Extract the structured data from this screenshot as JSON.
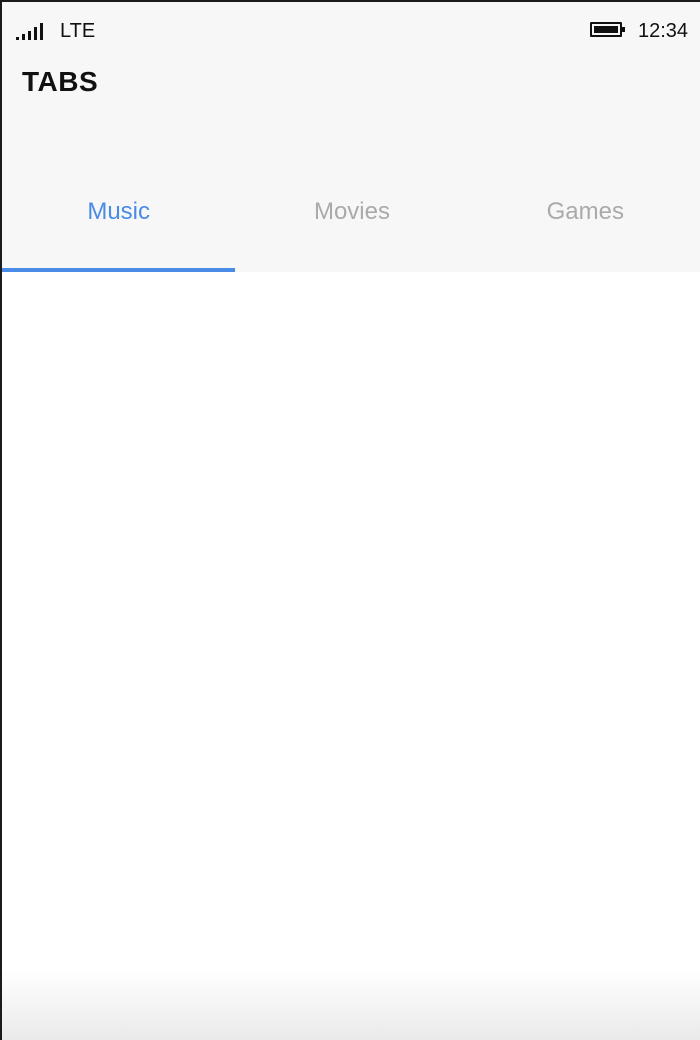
{
  "status_bar": {
    "network": "LTE",
    "time": "12:34"
  },
  "app": {
    "title": "TABS"
  },
  "tabs": [
    {
      "label": "Music",
      "active": true
    },
    {
      "label": "Movies",
      "active": false
    },
    {
      "label": "Games",
      "active": false
    }
  ],
  "colors": {
    "accent": "#4a8be6",
    "inactive_tab": "#aaaaaa",
    "header_bg": "#f7f7f7"
  }
}
